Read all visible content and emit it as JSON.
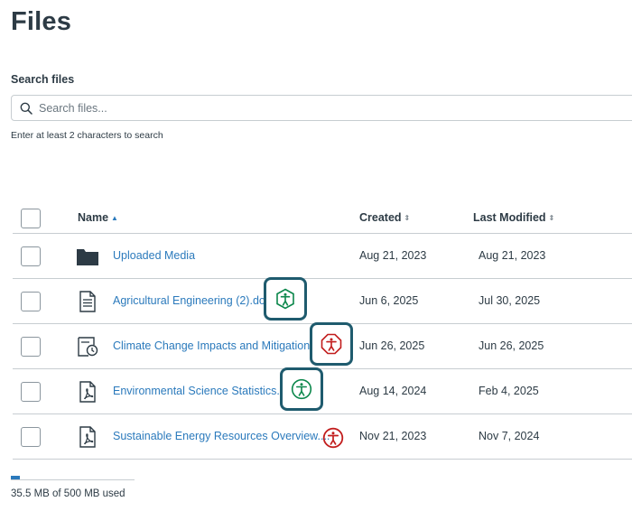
{
  "page": {
    "title": "Files"
  },
  "search": {
    "label": "Search files",
    "placeholder": "Search files...",
    "value": "",
    "hint": "Enter at least 2 characters to search"
  },
  "table": {
    "columns": [
      {
        "label": "Name",
        "sort": "▲"
      },
      {
        "label": "Created",
        "sort": "⇕"
      },
      {
        "label": "Last Modified",
        "sort": "⇕"
      }
    ],
    "rows": [
      {
        "icon": "folder-icon",
        "name": "Uploaded Media",
        "created": "Aug 21, 2023",
        "modified": "Aug 21, 2023",
        "a11y": "none"
      },
      {
        "icon": "document-icon",
        "name": "Agricultural Engineering (2).docx",
        "created": "Jun 6, 2025",
        "modified": "Jul 30, 2025",
        "a11y": "passed-hexagon"
      },
      {
        "icon": "scheduled-document-icon",
        "name": "Climate Change Impacts and Mitigation ...",
        "created": "Jun 26, 2025",
        "modified": "Jun 26, 2025",
        "a11y": "issues-octagon"
      },
      {
        "icon": "pdf-icon",
        "name": "Environmental Science Statistics.pdf",
        "created": "Aug 14, 2024",
        "modified": "Feb 4, 2025",
        "a11y": "passed-circle"
      },
      {
        "icon": "pdf-icon",
        "name": "Sustainable Energy Resources Overview....",
        "created": "Nov 21, 2023",
        "modified": "Nov 7, 2024",
        "a11y": "issues-circle"
      }
    ]
  },
  "colors": {
    "link": "#2b7abc",
    "text": "#2d3b45",
    "green": "#0b874b",
    "red": "#c21d1d",
    "focus": "#1f5b6e"
  },
  "storage": {
    "used_fraction": 0.071,
    "text": "35.5 MB of 500 MB used"
  }
}
